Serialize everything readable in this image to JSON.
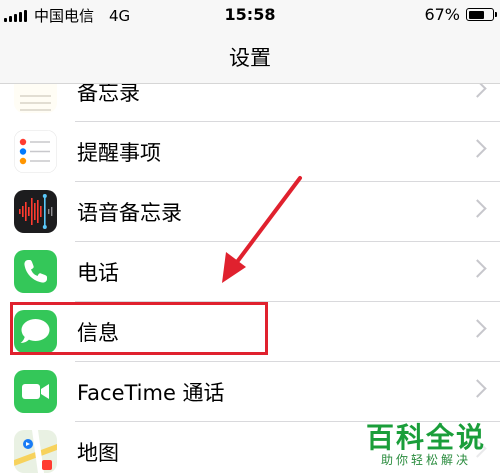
{
  "status_bar": {
    "carrier": "中国电信",
    "network": "4G",
    "time": "15:58",
    "battery_percent": "67%",
    "battery_level": 0.67
  },
  "nav": {
    "title": "设置"
  },
  "rows": [
    {
      "label": "备忘录",
      "icon": "notes-icon"
    },
    {
      "label": "提醒事项",
      "icon": "reminders-icon"
    },
    {
      "label": "语音备忘录",
      "icon": "voice-memos-icon"
    },
    {
      "label": "电话",
      "icon": "phone-icon"
    },
    {
      "label": "信息",
      "icon": "messages-icon"
    },
    {
      "label": "FaceTime 通话",
      "icon": "facetime-icon"
    },
    {
      "label": "地图",
      "icon": "maps-icon"
    }
  ],
  "colors": {
    "highlight": "#e0212e",
    "ios_green": "#34c759",
    "watermark_green": "#1a9e3a"
  },
  "watermark": {
    "title": "百科全说",
    "subtitle": "助你轻松解决"
  }
}
